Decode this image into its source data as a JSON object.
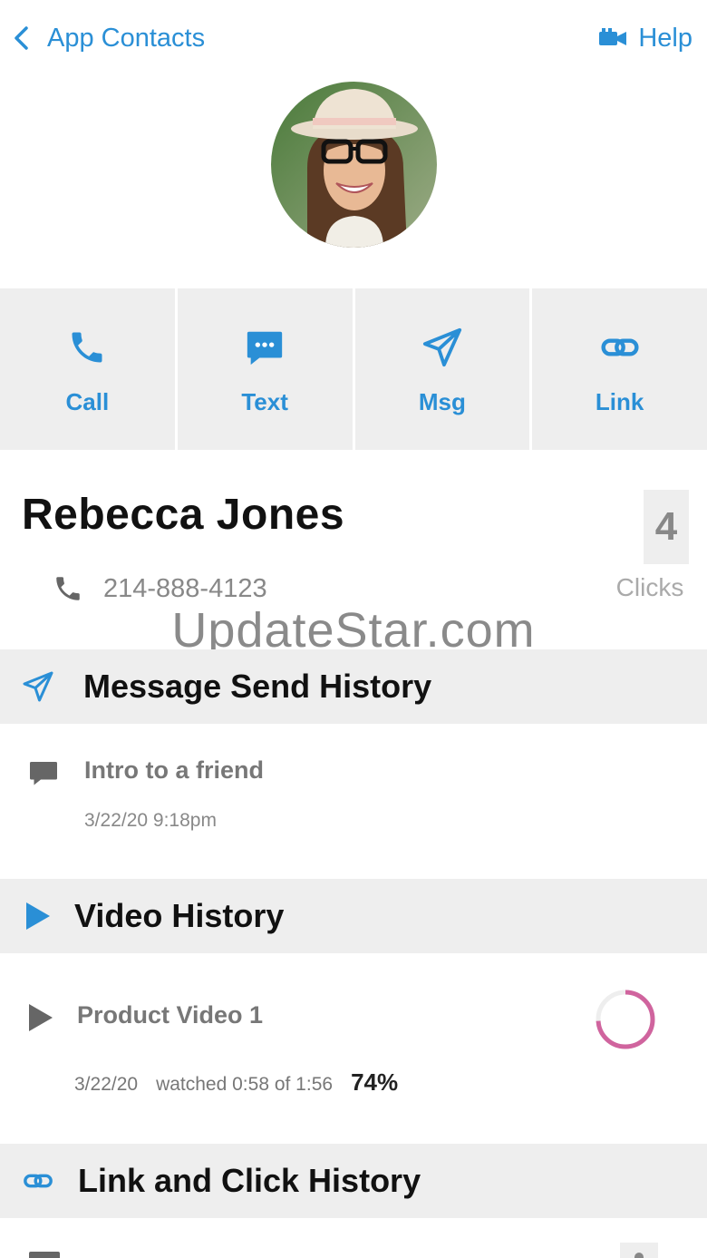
{
  "header": {
    "back_label": "App Contacts",
    "help_label": "Help"
  },
  "actions": [
    {
      "label": "Call",
      "icon": "phone-icon"
    },
    {
      "label": "Text",
      "icon": "chat-bubble-icon"
    },
    {
      "label": "Msg",
      "icon": "paper-plane-icon"
    },
    {
      "label": "Link",
      "icon": "link-icon"
    }
  ],
  "contact": {
    "name": "Rebecca Jones",
    "phone": "214-888-4123",
    "clicks_count": "4",
    "clicks_label": "Clicks"
  },
  "watermark": "UpdateStar.com",
  "message_history": {
    "title": "Message Send History",
    "items": [
      {
        "title": "Intro to a friend",
        "date": "3/22/20 9:18pm"
      }
    ]
  },
  "video_history": {
    "title": "Video History",
    "items": [
      {
        "title": "Product Video 1",
        "date": "3/22/20",
        "watched": "watched 0:58 of 1:56",
        "percent_label": "74%",
        "percent": 0.74
      }
    ]
  },
  "link_history": {
    "title": "Link and Click History"
  },
  "colors": {
    "accent": "#2a8fd6",
    "progress": "#d0649e",
    "panel": "#eeeeee"
  }
}
